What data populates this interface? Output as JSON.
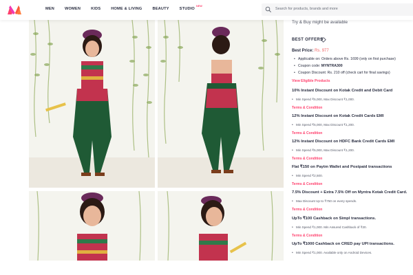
{
  "header": {
    "logo": "myntra-m-logo",
    "nav": [
      {
        "label": "MEN"
      },
      {
        "label": "WOMEN"
      },
      {
        "label": "KIDS"
      },
      {
        "label": "HOME & LIVING"
      },
      {
        "label": "BEAUTY"
      },
      {
        "label": "STUDIO",
        "badge": "NEW"
      }
    ],
    "search_placeholder": "Search for products, brands and more",
    "search_icon": "search-icon"
  },
  "gallery": {
    "images": [
      {
        "subject": "girl-front-view"
      },
      {
        "subject": "girl-back-view"
      },
      {
        "subject": "girl-front-closeup"
      },
      {
        "subject": "girl-side-closeup"
      }
    ]
  },
  "panel": {
    "try_buy": "Try & Buy might be available",
    "best_offers_title": "BEST OFFERS",
    "best_price_label": "Best Price:",
    "best_price_value": "Rs. 977",
    "best_price_points": {
      "p1": "Applicable on: Orders above Rs. 1699 (only on first purchase)",
      "p2_label": "Coupon code:",
      "p2_value": "MYNTRA300",
      "p3": "Coupon Discount: Rs. 210 off (check cart for final savings)"
    },
    "view_eligible": "View Eligible Products",
    "offers": [
      {
        "title": "10% Instant Discount on Kotak Credit and Debit Card",
        "detail": "Min Spend ₹5,000, Max Discount ₹1,000.",
        "terms": "Terms & Condition"
      },
      {
        "title": "12% Instant Discount on Kotak Credit Cards EMI",
        "detail": "Min Spend ₹5,000, Max Discount ₹1,200.",
        "terms": "Terms & Condition"
      },
      {
        "title": "12% Instant Discount on HDFC Bank Credit Cards EMI",
        "detail": "Min Spend ₹5,000, Max Discount ₹1,200.",
        "terms": "Terms & Condition"
      },
      {
        "title": "Flat ₹150 on Paytm Wallet and Postpaid transactions",
        "detail": "Min Spend ₹2,500.",
        "terms": "Terms & Condition"
      },
      {
        "title": "7.5% Discount + Extra 7.5% Off on Myntra Kotak Credit Card.",
        "detail": "Max Discount Up to ₹750 on every spends.",
        "terms": "Terms & Condition"
      },
      {
        "title": "UpTo ₹100 Cashback on Simpl transactions.",
        "detail": "Min Spend ₹1,000. Min Assured Cashback of ₹20.",
        "terms": "Terms & Condition"
      },
      {
        "title": "UpTo ₹1000 Cashback on CRED pay UPI transactions.",
        "detail": "Min Spend ₹1,000. Available only on Android Devices.",
        "terms": ""
      }
    ]
  },
  "colors": {
    "brand_pink": "#ff3f6c",
    "price_red": "#f16565",
    "text_dark": "#282c3f",
    "text_muted": "#535766"
  }
}
